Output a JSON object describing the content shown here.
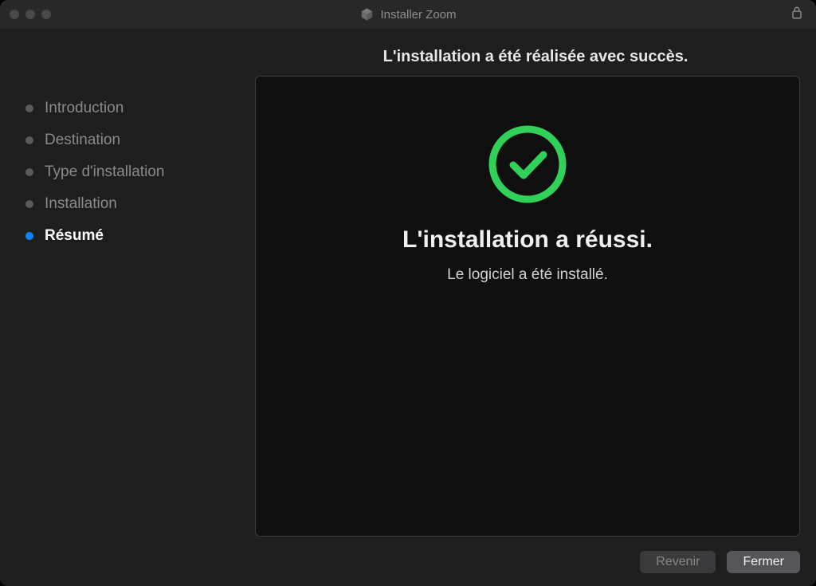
{
  "window": {
    "title": "Installer Zoom"
  },
  "header": {
    "subtitle": "L'installation a été réalisée avec succès."
  },
  "sidebar": {
    "steps": [
      {
        "label": "Introduction",
        "active": false
      },
      {
        "label": "Destination",
        "active": false
      },
      {
        "label": "Type d'installation",
        "active": false
      },
      {
        "label": "Installation",
        "active": false
      },
      {
        "label": "Résumé",
        "active": true
      }
    ]
  },
  "content": {
    "title": "L'installation a réussi.",
    "subtitle": "Le logiciel a été installé."
  },
  "footer": {
    "back_label": "Revenir",
    "close_label": "Fermer"
  }
}
